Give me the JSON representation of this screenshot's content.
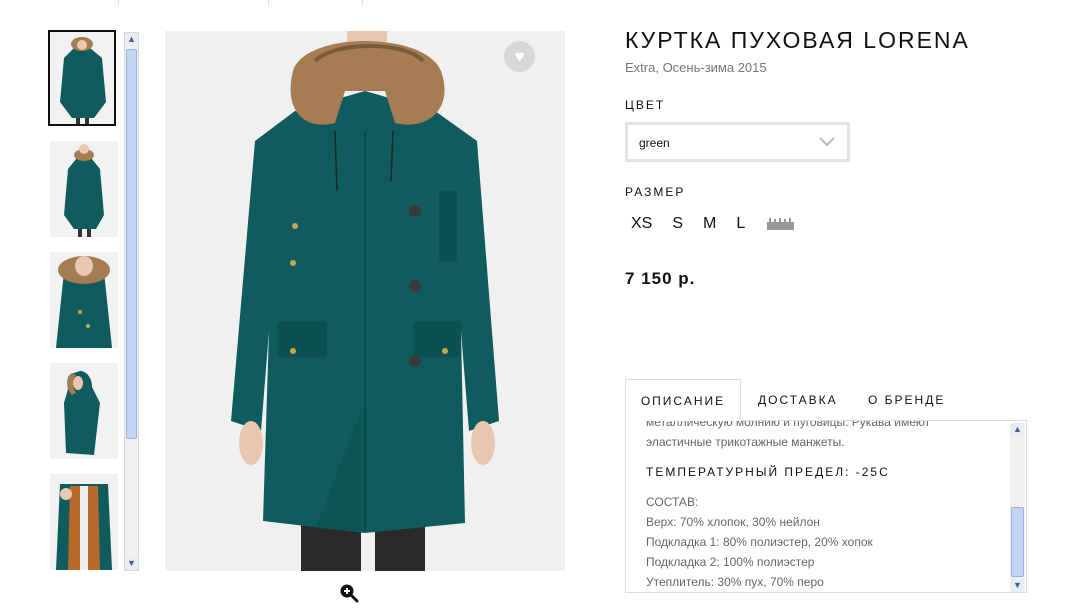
{
  "product": {
    "title": "КУРТКА ПУХОВАЯ LORENA",
    "subtitle": "Extra, Осень-зима 2015",
    "color_label": "ЦВЕТ",
    "color_value": "green",
    "size_label": "РАЗМЕР",
    "sizes": [
      "XS",
      "S",
      "M",
      "L"
    ],
    "price": "7 150 р."
  },
  "tabs": [
    {
      "label": "ОПИСАНИЕ",
      "active": true
    },
    {
      "label": "ДОСТАВКА",
      "active": false
    },
    {
      "label": "О БРЕНДЕ",
      "active": false
    }
  ],
  "description": {
    "line1": "металлическую молнию и пуговицы. Рукава имеют",
    "line2": "эластичные трикотажные манжеты.",
    "temp": "ТЕМПЕРАТУРНЫЙ ПРЕДЕЛ: -25С",
    "composition_label": "СОСТАВ:",
    "composition": [
      "Верх: 70% хлопок, 30% нейлон",
      "Подкладка 1: 80% полиэстер, 20% хопок",
      "Подкладка 2: 100% полиэстер",
      "Утеплитель: 30% пух, 70% перо"
    ]
  },
  "gallery": {
    "thumb_count": 5,
    "active_index": 0
  },
  "icons": {
    "favorite": "heart-icon",
    "zoom": "zoom-in-icon",
    "select": "chevron-down-icon",
    "size_chart": "ruler-icon",
    "scroll_up": "scroll-up-icon",
    "scroll_down": "scroll-down-icon"
  },
  "colors": {
    "jacket": "#0f5b5e",
    "fur": "#a07a52",
    "scrollbar": "#c5d3f5"
  }
}
